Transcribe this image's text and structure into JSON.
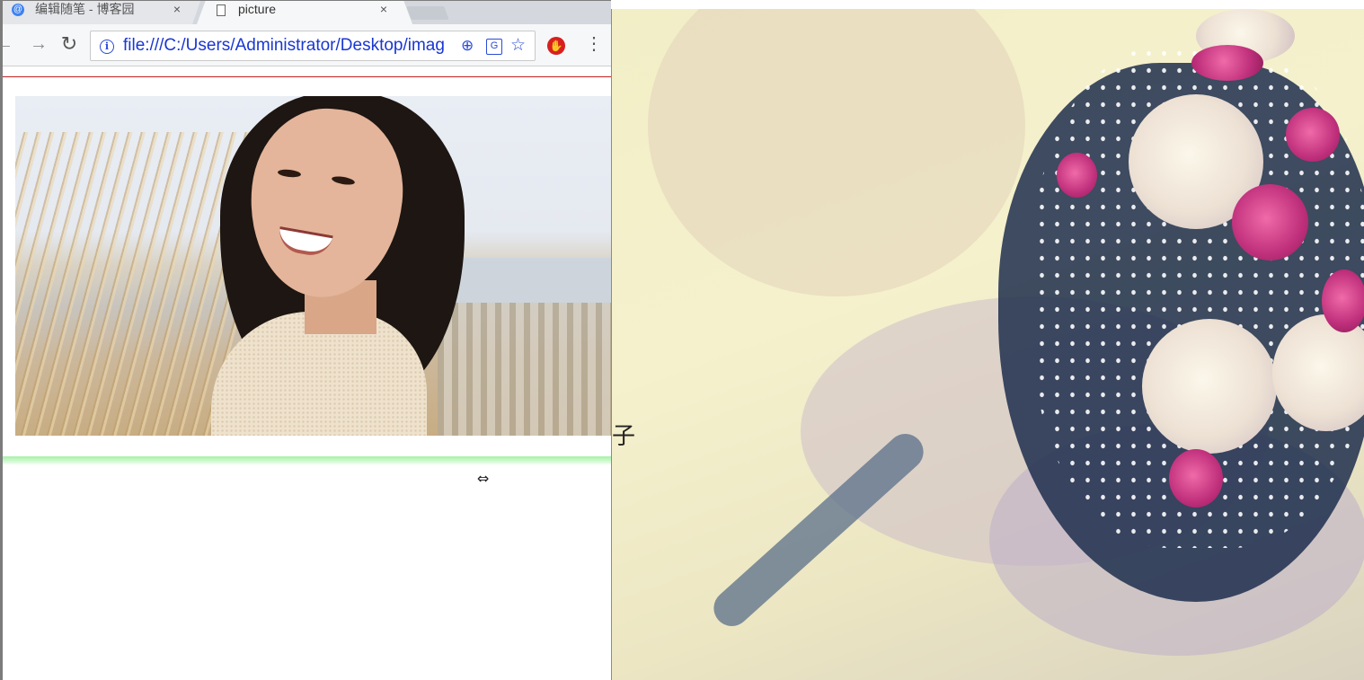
{
  "browser": {
    "tabs": [
      {
        "title": "编辑随笔 - 博客园",
        "close": "×",
        "active": false
      },
      {
        "title": "picture",
        "close": "×",
        "active": true
      }
    ],
    "address_bar": {
      "url": "file:///C:/Users/Administrator/Desktop/imag"
    },
    "icons": {
      "back": "back-arrow-icon",
      "forward": "forward-arrow-icon",
      "reload": "reload-icon",
      "info": "info-icon",
      "zoom": "zoom-icon",
      "translate": "translate-icon",
      "bookmark": "star-icon",
      "extension": "adblock-icon",
      "menu": "kebab-menu-icon"
    }
  },
  "page": {
    "image": "portrait photo of smiling woman with dark hair",
    "top_rule_color": "#c02020",
    "bottom_rule_color": "#a7f0a7"
  },
  "background": {
    "image": "bridal bouquet of white and pink roses",
    "stray_glyph": "子"
  },
  "colors": {
    "url_text": "#1a37d1",
    "divider": "#46b46e"
  }
}
